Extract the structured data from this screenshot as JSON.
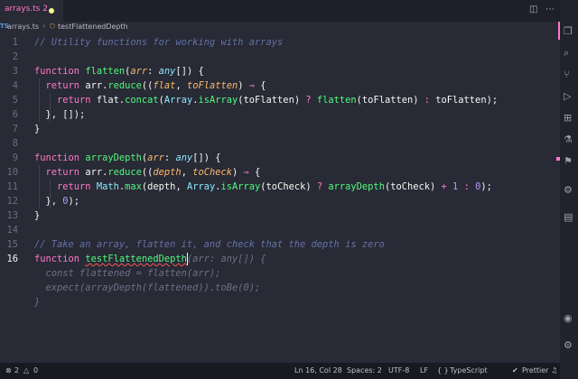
{
  "tab": {
    "title": "arrays.ts 2",
    "modified": true
  },
  "breadcrumb": {
    "lang_badge": "TS",
    "file": "arrays.ts",
    "separator": "›",
    "symbol": "testFlattenedDepth",
    "symbol_icon": "function-icon"
  },
  "editor": {
    "active_line": 16,
    "lines": [
      {
        "n": "1",
        "tokens": [
          [
            "c",
            "// Utility functions for working with arrays"
          ]
        ]
      },
      {
        "n": "2",
        "tokens": []
      },
      {
        "n": "3",
        "tokens": [
          [
            "k",
            "function "
          ],
          [
            "fn",
            "flatten"
          ],
          [
            "d",
            "("
          ],
          [
            "p",
            "arr"
          ],
          [
            "d",
            ": "
          ],
          [
            "t",
            "any"
          ],
          [
            "d",
            "[]) {"
          ]
        ]
      },
      {
        "n": "4",
        "tokens": [
          [
            "d",
            "  "
          ],
          [
            "k",
            "return "
          ],
          [
            "d",
            "arr."
          ],
          [
            "fn",
            "reduce"
          ],
          [
            "d",
            "(("
          ],
          [
            "p",
            "flat"
          ],
          [
            "d",
            ", "
          ],
          [
            "p",
            "toFlatten"
          ],
          [
            "d",
            ") "
          ],
          [
            "k",
            "⇒"
          ],
          [
            "d",
            " {"
          ]
        ]
      },
      {
        "n": "5",
        "tokens": [
          [
            "d",
            "    "
          ],
          [
            "k",
            "return "
          ],
          [
            "d",
            "flat."
          ],
          [
            "fn",
            "concat"
          ],
          [
            "d",
            "("
          ],
          [
            "cls",
            "Array"
          ],
          [
            "d",
            "."
          ],
          [
            "fn",
            "isArray"
          ],
          [
            "d",
            "(toFlatten) "
          ],
          [
            "k",
            "?"
          ],
          [
            "d",
            " "
          ],
          [
            "fn",
            "flatten"
          ],
          [
            "d",
            "(toFlatten) "
          ],
          [
            "k",
            ":"
          ],
          [
            "d",
            " toFlatten);"
          ]
        ]
      },
      {
        "n": "6",
        "tokens": [
          [
            "d",
            "  }, []);"
          ]
        ]
      },
      {
        "n": "7",
        "tokens": [
          [
            "d",
            "}"
          ]
        ]
      },
      {
        "n": "8",
        "tokens": []
      },
      {
        "n": "9",
        "tokens": [
          [
            "k",
            "function "
          ],
          [
            "fn",
            "arrayDepth"
          ],
          [
            "d",
            "("
          ],
          [
            "p",
            "arr"
          ],
          [
            "d",
            ": "
          ],
          [
            "t",
            "any"
          ],
          [
            "d",
            "[]) {"
          ]
        ]
      },
      {
        "n": "10",
        "tokens": [
          [
            "d",
            "  "
          ],
          [
            "k",
            "return "
          ],
          [
            "d",
            "arr."
          ],
          [
            "fn",
            "reduce"
          ],
          [
            "d",
            "(("
          ],
          [
            "p",
            "depth"
          ],
          [
            "d",
            ", "
          ],
          [
            "p",
            "toCheck"
          ],
          [
            "d",
            ") "
          ],
          [
            "k",
            "⇒"
          ],
          [
            "d",
            " {"
          ]
        ]
      },
      {
        "n": "11",
        "tokens": [
          [
            "d",
            "    "
          ],
          [
            "k",
            "return "
          ],
          [
            "cls",
            "Math"
          ],
          [
            "d",
            "."
          ],
          [
            "fn",
            "max"
          ],
          [
            "d",
            "(depth, "
          ],
          [
            "cls",
            "Array"
          ],
          [
            "d",
            "."
          ],
          [
            "fn",
            "isArray"
          ],
          [
            "d",
            "(toCheck) "
          ],
          [
            "k",
            "?"
          ],
          [
            "d",
            " "
          ],
          [
            "fn",
            "arrayDepth"
          ],
          [
            "d",
            "(toCheck) "
          ],
          [
            "k",
            "+"
          ],
          [
            "d",
            " "
          ],
          [
            "n",
            "1"
          ],
          [
            "d",
            " "
          ],
          [
            "k",
            ":"
          ],
          [
            "d",
            " "
          ],
          [
            "n",
            "0"
          ],
          [
            "d",
            ");"
          ]
        ]
      },
      {
        "n": "12",
        "tokens": [
          [
            "d",
            "  }, "
          ],
          [
            "n",
            "0"
          ],
          [
            "d",
            ");"
          ]
        ]
      },
      {
        "n": "13",
        "tokens": [
          [
            "d",
            "}"
          ]
        ]
      },
      {
        "n": "14",
        "tokens": []
      },
      {
        "n": "15",
        "tokens": [
          [
            "c",
            "// Take an array, flatten it, and check that the depth is zero"
          ]
        ]
      },
      {
        "n": "16",
        "tokens": [
          [
            "k",
            "function "
          ],
          [
            "fn sq",
            "testFlattenedDepth"
          ],
          [
            "ghost",
            "(arr: any[]) {"
          ]
        ]
      },
      {
        "n": "",
        "tokens": [
          [
            "ghost",
            "  const flattened = flatten(arr);"
          ]
        ]
      },
      {
        "n": "",
        "tokens": [
          [
            "ghost",
            "  expect(arrayDepth(flattened)).toBe(0);"
          ]
        ]
      },
      {
        "n": "",
        "tokens": [
          [
            "ghost",
            "}"
          ]
        ]
      }
    ]
  },
  "statusbar": {
    "errors": "2",
    "warnings": "0",
    "position": "Ln 16, Col 28",
    "spaces": "Spaces: 2",
    "encoding": "UTF-8",
    "eol": "LF",
    "braces": "{ }",
    "language": "TypeScript",
    "formatter": "Prettier"
  },
  "colors": {
    "accent": "#ff79c6",
    "background": "#282a36",
    "statusbar": "#191a21"
  }
}
